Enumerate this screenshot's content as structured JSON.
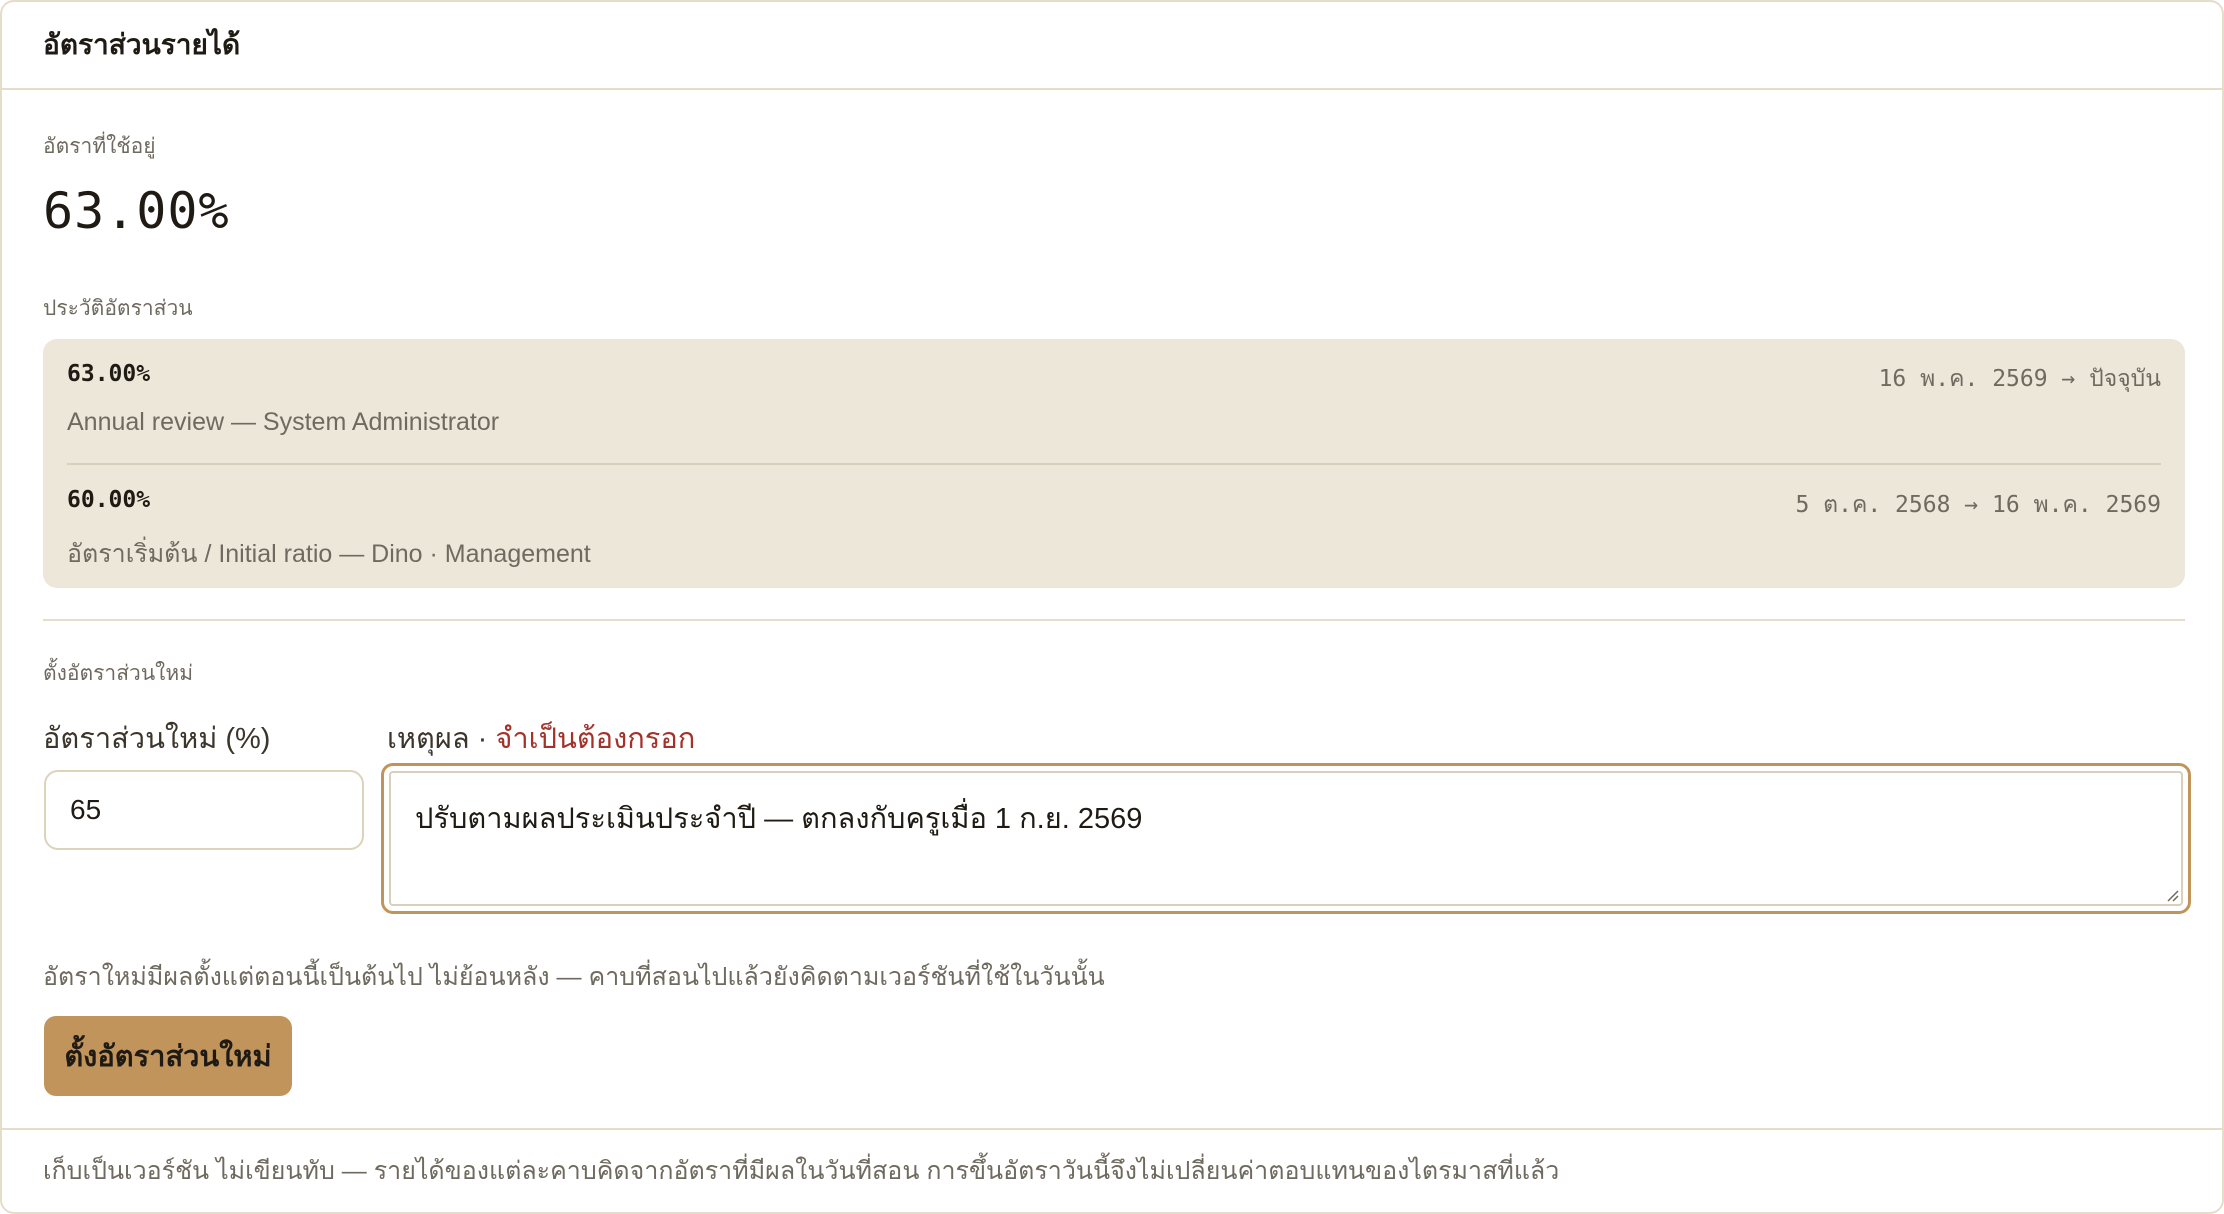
{
  "card": {
    "title": "อัตราส่วนรายได้"
  },
  "current": {
    "label": "อัตราที่ใช้อยู่",
    "value": "63.00%"
  },
  "history": {
    "label": "ประวัติอัตราส่วน",
    "items": [
      {
        "ratio": "63.00%",
        "range": "16 พ.ค. 2569 → ปัจจุบัน",
        "note": "Annual review — System Administrator"
      },
      {
        "ratio": "60.00%",
        "range": "5 ต.ค. 2568 → 16 พ.ค. 2569",
        "note": "อัตราเริ่มต้น / Initial ratio — Dino · Management"
      }
    ]
  },
  "new_ratio": {
    "section_label": "ตั้งอัตราส่วนใหม่",
    "ratio_label": "อัตราส่วนใหม่ (%)",
    "ratio_value": "65",
    "reason_label": "เหตุผล ·",
    "reason_required": "จำเป็นต้องกรอก",
    "reason_value": "ปรับตามผลประเมินประจำปี — ตกลงกับครูเมื่อ 1 ก.ย. 2569",
    "hint": "อัตราใหม่มีผลตั้งแต่ตอนนี้เป็นต้นไป ไม่ย้อนหลัง — คาบที่สอนไปแล้วยังคิดตามเวอร์ชันที่ใช้ในวันนั้น",
    "submit_label": "ตั้งอัตราส่วนใหม่"
  },
  "footer": {
    "text": "เก็บเป็นเวอร์ชัน ไม่เขียนทับ — รายได้ของแต่ละคาบคิดจากอัตราที่มีผลในวันที่สอน การขึ้นอัตราวันนี้จึงไม่เปลี่ยนค่าตอบแทนของไตรมาสที่แล้ว"
  },
  "colors": {
    "accent": "#c0945a",
    "panel": "#ede7da",
    "border": "#e4ddc9",
    "required": "#a3322a",
    "muted_text": "#6f6a5f"
  }
}
